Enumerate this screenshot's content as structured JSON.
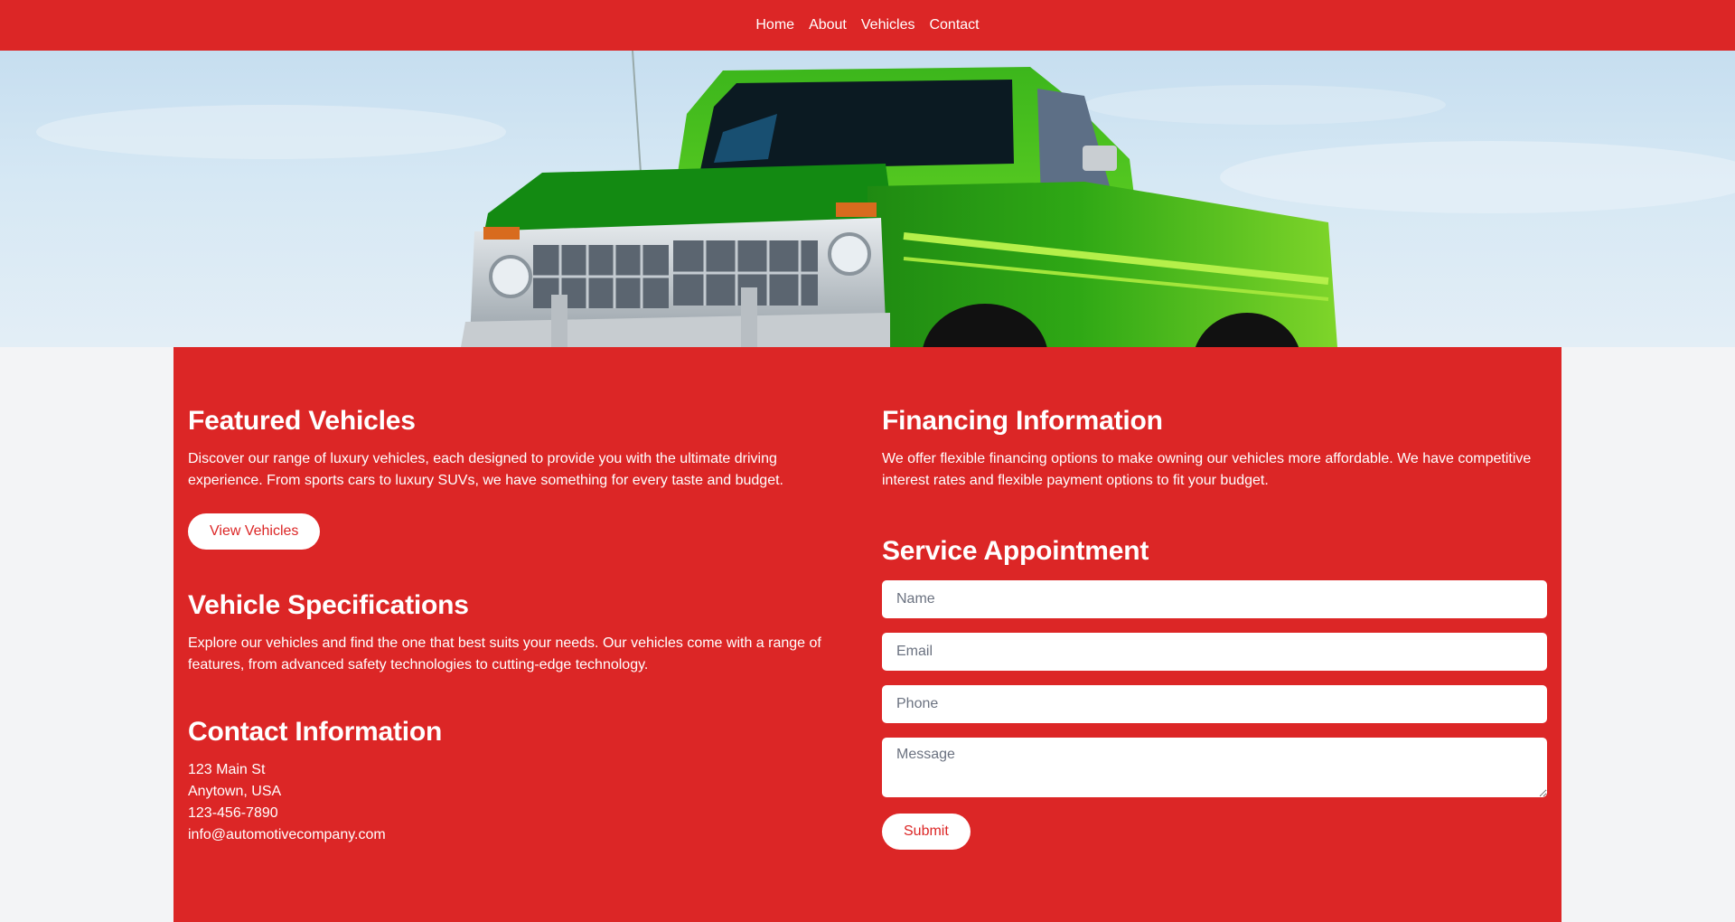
{
  "nav": {
    "items": [
      {
        "label": "Home"
      },
      {
        "label": "About"
      },
      {
        "label": "Vehicles"
      },
      {
        "label": "Contact"
      }
    ]
  },
  "hero": {
    "image_subject": "green-pickup-truck",
    "colors": {
      "sky": "#c6def0",
      "truck": "#3fb81c"
    }
  },
  "theme": {
    "accent": "#dc2626",
    "page_bg": "#f3f4f6"
  },
  "featured": {
    "title": "Featured Vehicles",
    "text": "Discover our range of luxury vehicles, each designed to provide you with the ultimate driving experience. From sports cars to luxury SUVs, we have something for every taste and budget.",
    "button_label": "View Vehicles"
  },
  "specs": {
    "title": "Vehicle Specifications",
    "text": "Explore our vehicles and find the one that best suits your needs. Our vehicles come with a range of features, from advanced safety technologies to cutting-edge technology."
  },
  "contact": {
    "title": "Contact Information",
    "address_line1": "123 Main St",
    "address_line2": "Anytown, USA",
    "phone": "123-456-7890",
    "email": "info@automotivecompany.com"
  },
  "financing": {
    "title": "Financing Information",
    "text": "We offer flexible financing options to make owning our vehicles more affordable. We have competitive interest rates and flexible payment options to fit your budget."
  },
  "service": {
    "title": "Service Appointment",
    "name_placeholder": "Name",
    "email_placeholder": "Email",
    "phone_placeholder": "Phone",
    "message_placeholder": "Message",
    "submit_label": "Submit"
  }
}
